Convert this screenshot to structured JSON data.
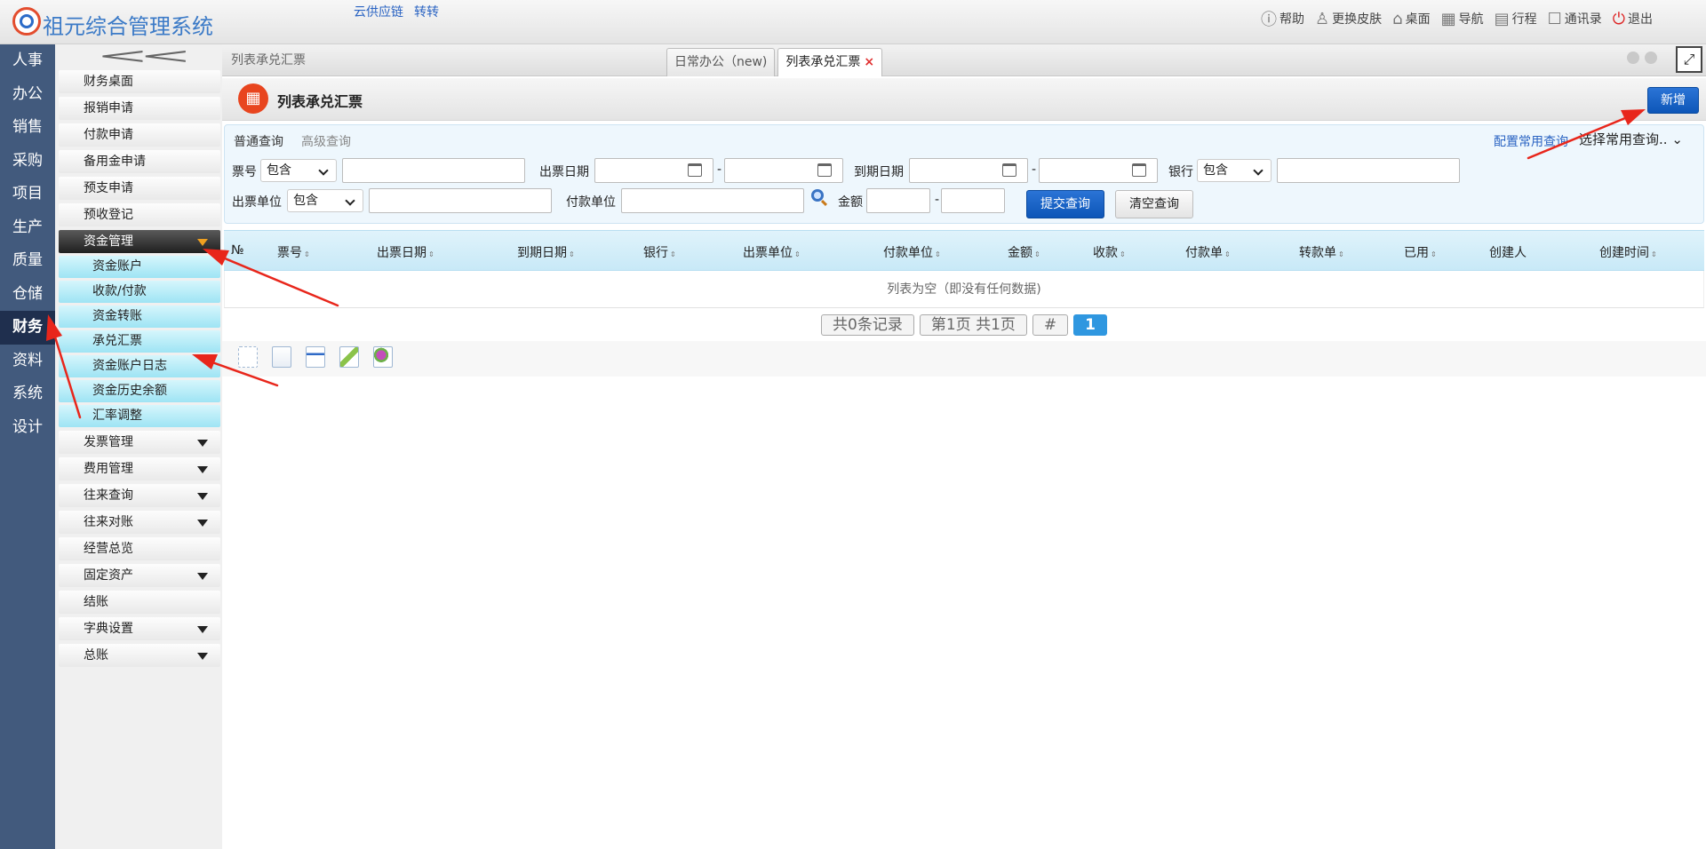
{
  "app": {
    "title": "祖元综合管理系统",
    "top_links": [
      "云供应链",
      "转转"
    ],
    "top_actions": [
      {
        "icon": "help-icon",
        "label": "帮助"
      },
      {
        "icon": "shirt-icon",
        "label": "更换皮肤"
      },
      {
        "icon": "home-icon",
        "label": "桌面"
      },
      {
        "icon": "grid-icon",
        "label": "导航"
      },
      {
        "icon": "calendar-icon",
        "label": "行程"
      },
      {
        "icon": "contacts-icon",
        "label": "通讯录"
      },
      {
        "icon": "power-icon",
        "label": "退出"
      }
    ]
  },
  "rail": {
    "items": [
      "人事",
      "办公",
      "销售",
      "采购",
      "项目",
      "生产",
      "质量",
      "仓储",
      "财务",
      "资料",
      "系统",
      "设计"
    ],
    "active": "财务"
  },
  "submenu": {
    "items": [
      {
        "label": "财务桌面"
      },
      {
        "label": "报销申请"
      },
      {
        "label": "付款申请"
      },
      {
        "label": "备用金申请"
      },
      {
        "label": "预支申请"
      },
      {
        "label": "预收登记"
      },
      {
        "label": "资金管理"
      },
      {
        "label": "发票管理"
      },
      {
        "label": "费用管理"
      },
      {
        "label": "往来查询"
      },
      {
        "label": "往来对账"
      },
      {
        "label": "经营总览"
      },
      {
        "label": "固定资产"
      },
      {
        "label": "结账"
      },
      {
        "label": "字典设置"
      },
      {
        "label": "总账"
      }
    ],
    "children": [
      "资金账户",
      "收款/付款",
      "资金转账",
      "承兑汇票",
      "资金账户日志",
      "资金历史余额",
      "汇率调整"
    ]
  },
  "tabbar": {
    "breadcrumb": "列表承兑汇票",
    "tabs": [
      {
        "label": "日常办公（new)"
      },
      {
        "label": "列表承兑汇票",
        "close": "×"
      }
    ]
  },
  "page": {
    "title": "列表承兑汇票",
    "add_label": "新增"
  },
  "query": {
    "tab_basic": "普通查询",
    "tab_advanced": "高级查询",
    "config": "配置常用查询",
    "saved_select": "选择常用查询..",
    "ticket_no": "票号",
    "contains": "包含",
    "issue_date": "出票日期",
    "due_date": "到期日期",
    "bank": "银行",
    "issuer": "出票单位",
    "payer": "付款单位",
    "amount": "金额",
    "dash": "-",
    "submit": "提交查询",
    "clear": "清空查询"
  },
  "grid": {
    "no_col": "№",
    "columns": [
      "票号",
      "出票日期",
      "到期日期",
      "银行",
      "出票单位",
      "付款单位",
      "金额",
      "收款",
      "付款单",
      "转款单",
      "已用",
      "创建人",
      "创建时间"
    ],
    "sort_mark": "⇕",
    "empty": "列表为空（即没有任何数据)"
  },
  "pager": {
    "total": "共0条记录",
    "page": "第1页 共1页",
    "hash": "#",
    "current": "1"
  },
  "colors": {
    "rail": "#425a7d",
    "primary": "#0d56b8",
    "arrow": "#e8261b"
  }
}
